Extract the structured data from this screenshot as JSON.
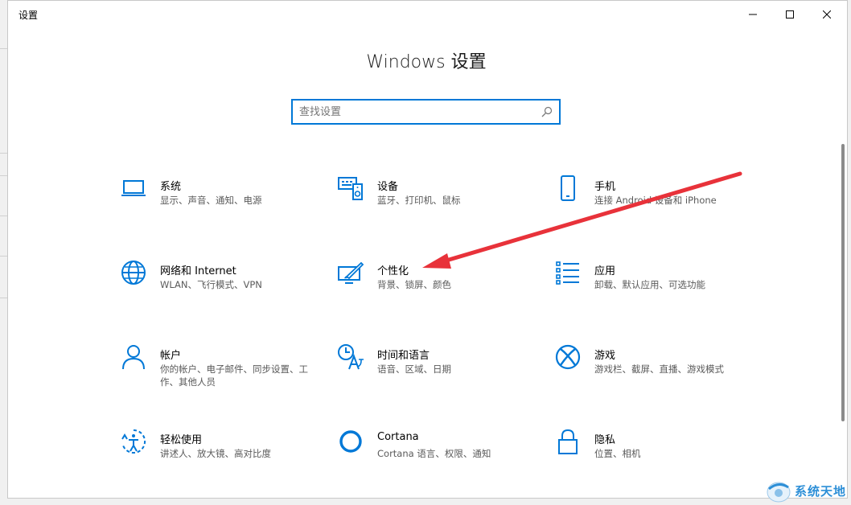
{
  "window": {
    "app_title": "设置",
    "page_title": "Windows 设置"
  },
  "search": {
    "placeholder": "查找设置"
  },
  "tiles": [
    {
      "title": "系统",
      "desc": "显示、声音、通知、电源",
      "icon": "laptop-icon"
    },
    {
      "title": "设备",
      "desc": "蓝牙、打印机、鼠标",
      "icon": "devices-icon"
    },
    {
      "title": "手机",
      "desc": "连接 Android 设备和 iPhone",
      "icon": "phone-icon"
    },
    {
      "title": "网络和 Internet",
      "desc": "WLAN、飞行模式、VPN",
      "icon": "globe-icon"
    },
    {
      "title": "个性化",
      "desc": "背景、锁屏、颜色",
      "icon": "personalization-icon"
    },
    {
      "title": "应用",
      "desc": "卸载、默认应用、可选功能",
      "icon": "apps-list-icon"
    },
    {
      "title": "帐户",
      "desc": "你的帐户、电子邮件、同步设置、工作、其他人员",
      "icon": "person-icon"
    },
    {
      "title": "时间和语言",
      "desc": "语音、区域、日期",
      "icon": "time-language-icon"
    },
    {
      "title": "游戏",
      "desc": "游戏栏、截屏、直播、游戏模式",
      "icon": "xbox-icon"
    },
    {
      "title": "轻松使用",
      "desc": "讲述人、放大镜、高对比度",
      "icon": "ease-of-access-icon"
    },
    {
      "title": "Cortana",
      "desc": "Cortana 语言、权限、通知",
      "icon": "cortana-icon"
    },
    {
      "title": "隐私",
      "desc": "位置、相机",
      "icon": "lock-icon"
    }
  ],
  "watermark": {
    "text": "系统天地"
  },
  "colors": {
    "accent": "#0078d7",
    "arrow": "#e8323a"
  }
}
